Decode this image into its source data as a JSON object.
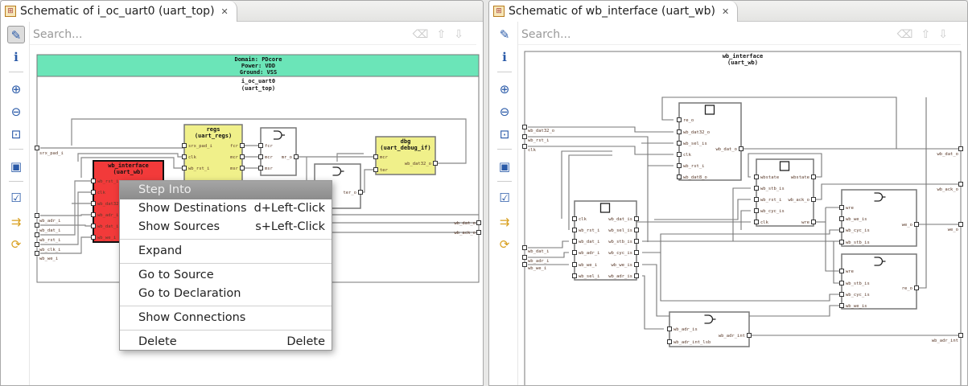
{
  "left": {
    "tab_title": "Schematic of i_oc_uart0 (uart_top)",
    "search_placeholder": "Search...",
    "domain": [
      "Domain: PDcore",
      "Power: VDD",
      "Ground: VSS"
    ],
    "title": "i_oc_uart0",
    "subtitle": "(uart_top)",
    "in_ports": [
      "srx_pad_i",
      "wb_adr_i",
      "wb_dat_i",
      "wb_rst_i",
      "wb_clk_i",
      "wb_we_i"
    ],
    "out_ports": [
      "wb_dat_o",
      "wb_ack_o"
    ],
    "blocks": [
      {
        "id": "regs",
        "title": "regs",
        "subtitle": "(uart_regs)",
        "inputs": [
          "srx_pad_i",
          "clk",
          "wb_rst_i"
        ],
        "outputs": [
          "fcr",
          "mcr",
          "msr"
        ]
      },
      {
        "id": "mux1",
        "title": "",
        "subtitle": "",
        "inputs": [
          "fcr",
          "mcr",
          "msr"
        ],
        "outputs": [
          "mr_o"
        ]
      },
      {
        "id": "dbg",
        "title": "dbg",
        "subtitle": "(uart_debug_if)",
        "inputs": [
          "mcr",
          "ter"
        ],
        "outputs": [
          "wb_dat32_o"
        ]
      },
      {
        "id": "mux2",
        "title": "",
        "subtitle": "",
        "inputs": [],
        "outputs": [
          "ter_o"
        ]
      },
      {
        "id": "wbif",
        "title": "wb_interface",
        "subtitle": "(uart_wb)",
        "inputs": [
          "wb_rst_i",
          "clk",
          "wb_dat32_",
          "wb_adr_i",
          "wb_dat_i",
          "wb_we_i"
        ],
        "outputs": []
      }
    ]
  },
  "right": {
    "tab_title": "Schematic of wb_interface (uart_wb)",
    "search_placeholder": "Search...",
    "title": "wb_interface",
    "subtitle": "(uart_wb)",
    "in_ports": [
      "wb_dat32_o",
      "wb_rst_i",
      "clk",
      "wb_dat_i",
      "wb_adr_i",
      "wb_we_i"
    ],
    "out_ports": [
      "wb_dat_o",
      "wb_ack_o",
      "we_o",
      "wb_adr_int"
    ],
    "blocks": [
      {
        "id": "A",
        "inputs": [
          "re_o",
          "wb_dat32_o",
          "wb_sel_is",
          "clk",
          "wb_rst_i",
          "wb_dat8_o"
        ],
        "outputs": [
          "wb_dat_o"
        ]
      },
      {
        "id": "B",
        "inputs": [
          "wbstate",
          "wb_stb_is",
          "wb_rst_i",
          "wb_cyc_is",
          "clk"
        ],
        "outputs": [
          "wbstate",
          "wb_ack_o",
          "wre"
        ]
      },
      {
        "id": "C",
        "inputs": [
          "clk",
          "wb_rst_i",
          "wb_dat_i",
          "wb_adr_i",
          "wb_we_i",
          "wb_sel_i"
        ],
        "outputs": [
          "wb_dat_is",
          "wb_sel_is",
          "wb_stb_is",
          "wb_cyc_is",
          "wb_we_is",
          "wb_adr_is"
        ]
      },
      {
        "id": "D",
        "inputs": [
          "wre",
          "wb_we_is",
          "wb_cyc_is",
          "wb_stb_is"
        ],
        "outputs": [
          "we_o"
        ]
      },
      {
        "id": "E",
        "inputs": [
          "wre",
          "wb_stb_is",
          "wb_cyc_is",
          "wb_we_is"
        ],
        "outputs": [
          "re_o"
        ]
      },
      {
        "id": "F",
        "inputs": [
          "wb_adr_is",
          "wb_adr_int_lsb"
        ],
        "outputs": [
          "wb_adr_int"
        ]
      }
    ]
  },
  "toolbar_icons": [
    "select-icon",
    "info-icon",
    "zoom-in-icon",
    "zoom-out-icon",
    "zoom-fit-icon",
    "save-icon",
    "checklist-icon",
    "expand-ports-icon",
    "refresh-icon"
  ],
  "context_menu": [
    {
      "label": "Step Into",
      "shortcut": ""
    },
    {
      "label": "Show Destinations",
      "shortcut": "d+Left-Click"
    },
    {
      "label": "Show Sources",
      "shortcut": "s+Left-Click"
    },
    {
      "label": "Expand",
      "shortcut": ""
    },
    {
      "label": "Go to Source",
      "shortcut": ""
    },
    {
      "label": "Go to Declaration",
      "shortcut": ""
    },
    {
      "label": "Show Connections",
      "shortcut": ""
    },
    {
      "label": "Delete",
      "shortcut": "Delete"
    }
  ],
  "colors": {
    "domain": "#6be5b8",
    "hier_block": "#f0f08a",
    "selected_block": "#f23a3a",
    "menu_highlight": "#999999"
  }
}
